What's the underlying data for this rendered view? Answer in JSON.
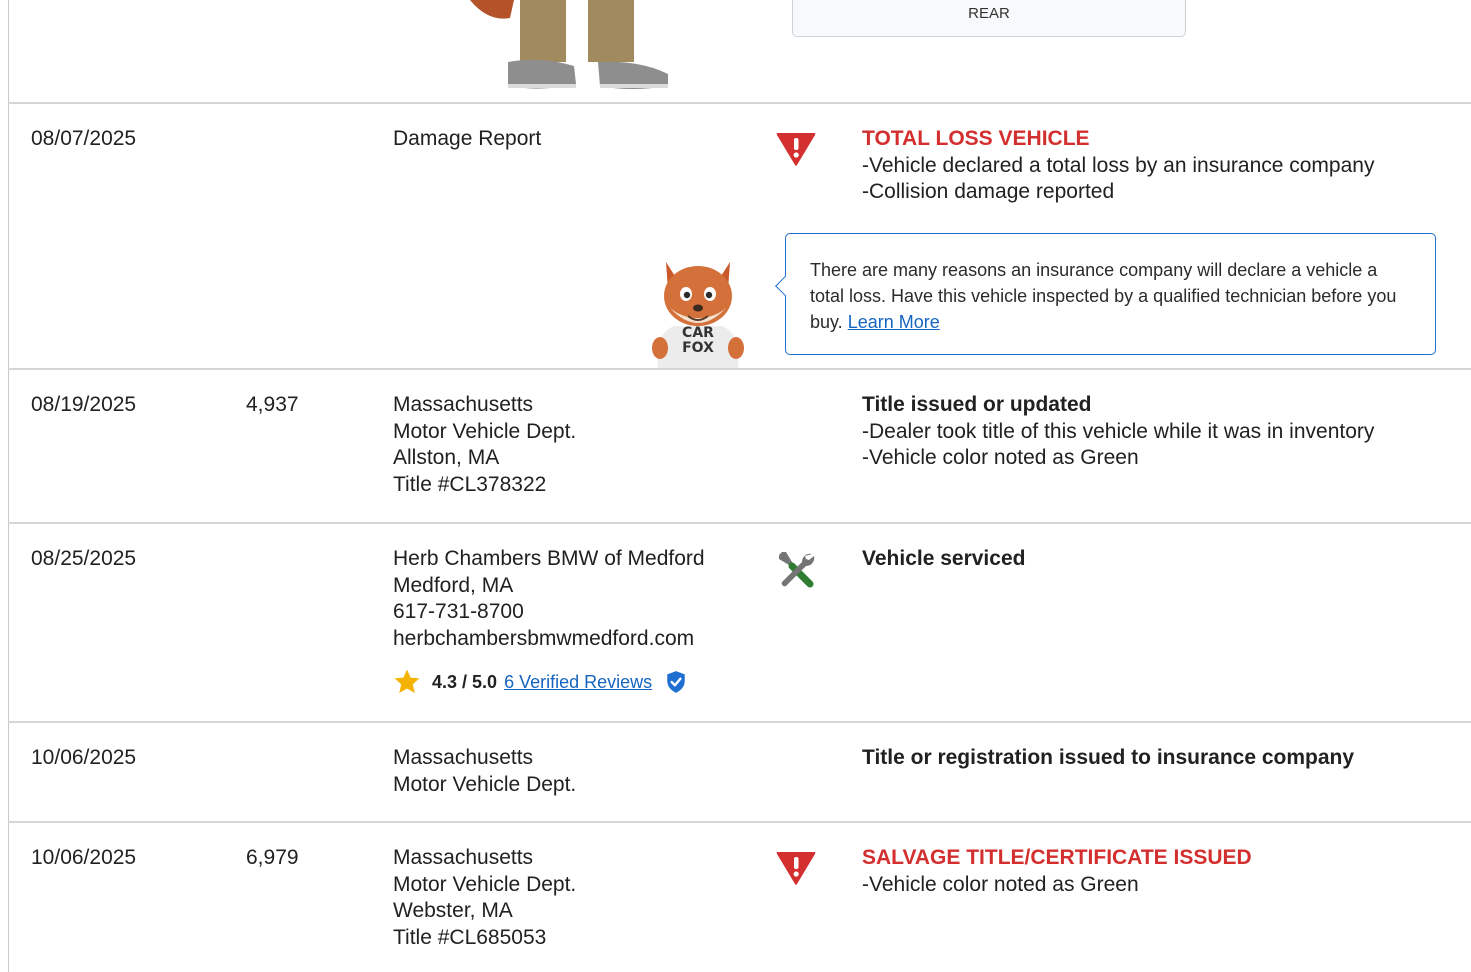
{
  "photo_box": {
    "label": "REAR"
  },
  "records": [
    {
      "date": "08/07/2025",
      "odometer": "",
      "source": [
        "Damage Report"
      ],
      "icon": "alert-triangle-icon",
      "heading": "TOTAL LOSS VEHICLE",
      "heading_style": "alert",
      "details": [
        "Vehicle declared a total loss by an insurance company",
        "Collision damage reported"
      ],
      "tip": {
        "text": "There are many reasons an insurance company will declare a vehicle a total loss. Have this vehicle inspected by a qualified technician before you buy.",
        "link": "Learn More",
        "mascot_shirt": [
          "CAR",
          "FOX"
        ]
      }
    },
    {
      "date": "08/19/2025",
      "odometer": "4,937",
      "source": [
        "Massachusetts",
        "Motor Vehicle Dept.",
        "Allston, MA",
        "Title #CL378322"
      ],
      "heading": "Title issued or updated",
      "details": [
        "Dealer took title of this vehicle while it was in inventory",
        "Vehicle color noted as Green"
      ]
    },
    {
      "date": "08/25/2025",
      "odometer": "",
      "source": [
        "Herb Chambers BMW of Medford",
        "Medford, MA",
        "617-731-8700",
        "herbchambersbmwmedford.com"
      ],
      "icon": "wrench-screwdriver-icon",
      "heading": "Vehicle serviced",
      "rating": {
        "score": "4.3 / 5.0",
        "reviews_link": "6 Verified Reviews"
      }
    },
    {
      "date": "10/06/2025",
      "odometer": "",
      "source": [
        "Massachusetts",
        "Motor Vehicle Dept."
      ],
      "heading": "Title or registration issued to insurance company"
    },
    {
      "date": "10/06/2025",
      "odometer": "6,979",
      "source": [
        "Massachusetts",
        "Motor Vehicle Dept.",
        "Webster, MA",
        "Title #CL685053"
      ],
      "icon": "alert-triangle-icon",
      "heading": "SALVAGE TITLE/CERTIFICATE ISSUED",
      "heading_style": "alert",
      "details": [
        "Vehicle color noted as Green"
      ]
    }
  ],
  "colors": {
    "alert": "#d32f2f",
    "link": "#1565c0",
    "service_green": "#2e7d32",
    "verified_blue": "#1e6fd0",
    "star": "#f5b301"
  }
}
